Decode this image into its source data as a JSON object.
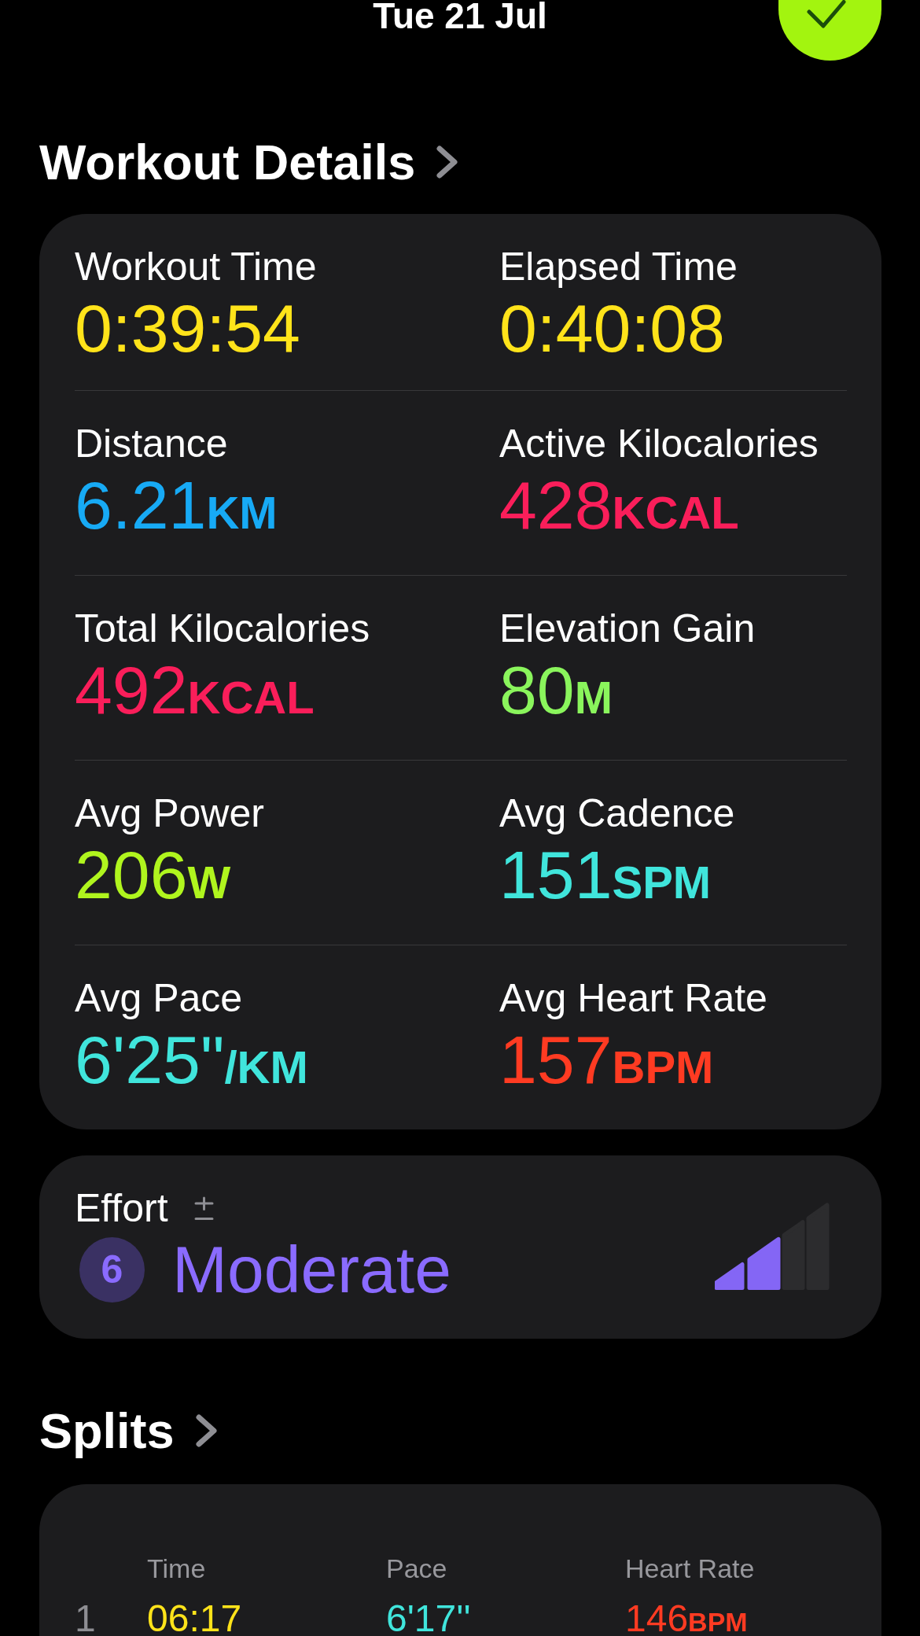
{
  "header": {
    "date": "Tue 21 Jul"
  },
  "workout_details": {
    "title": "Workout Details",
    "metrics": [
      {
        "label": "Workout Time",
        "value": "0:39:54",
        "color": "#ffe31a"
      },
      {
        "label": "Elapsed Time",
        "value": "0:40:08",
        "color": "#ffe31a"
      },
      {
        "label": "Distance",
        "value": "6.21",
        "unit": "KM",
        "color": "#17aaf5"
      },
      {
        "label": "Active Kilocalories",
        "value": "428",
        "unit": "KCAL",
        "color": "#fa1e5a"
      },
      {
        "label": "Total Kilocalories",
        "value": "492",
        "unit": "KCAL",
        "color": "#fa1e5a"
      },
      {
        "label": "Elevation Gain",
        "value": "80",
        "unit": "M",
        "color": "#8af55c"
      },
      {
        "label": "Avg Power",
        "value": "206",
        "unit": "W",
        "color": "#b0f51e"
      },
      {
        "label": "Avg Cadence",
        "value": "151",
        "unit": "SPM",
        "color": "#40e5dc"
      },
      {
        "label": "Avg Pace",
        "value": "6'25\"",
        "unit": "/KM",
        "color": "#40e5dc"
      },
      {
        "label": "Avg Heart Rate",
        "value": "157",
        "unit": "BPM",
        "color": "#ff3b22"
      }
    ]
  },
  "effort": {
    "label": "Effort",
    "score": "6",
    "rating": "Moderate",
    "level": 0.5
  },
  "splits": {
    "title": "Splits",
    "columns": [
      "Time",
      "Pace",
      "Heart Rate"
    ],
    "rows": [
      {
        "index": "1",
        "time": "06:17",
        "pace": "6'17''",
        "heart_rate": "146",
        "heart_rate_unit": "BPM"
      }
    ]
  }
}
